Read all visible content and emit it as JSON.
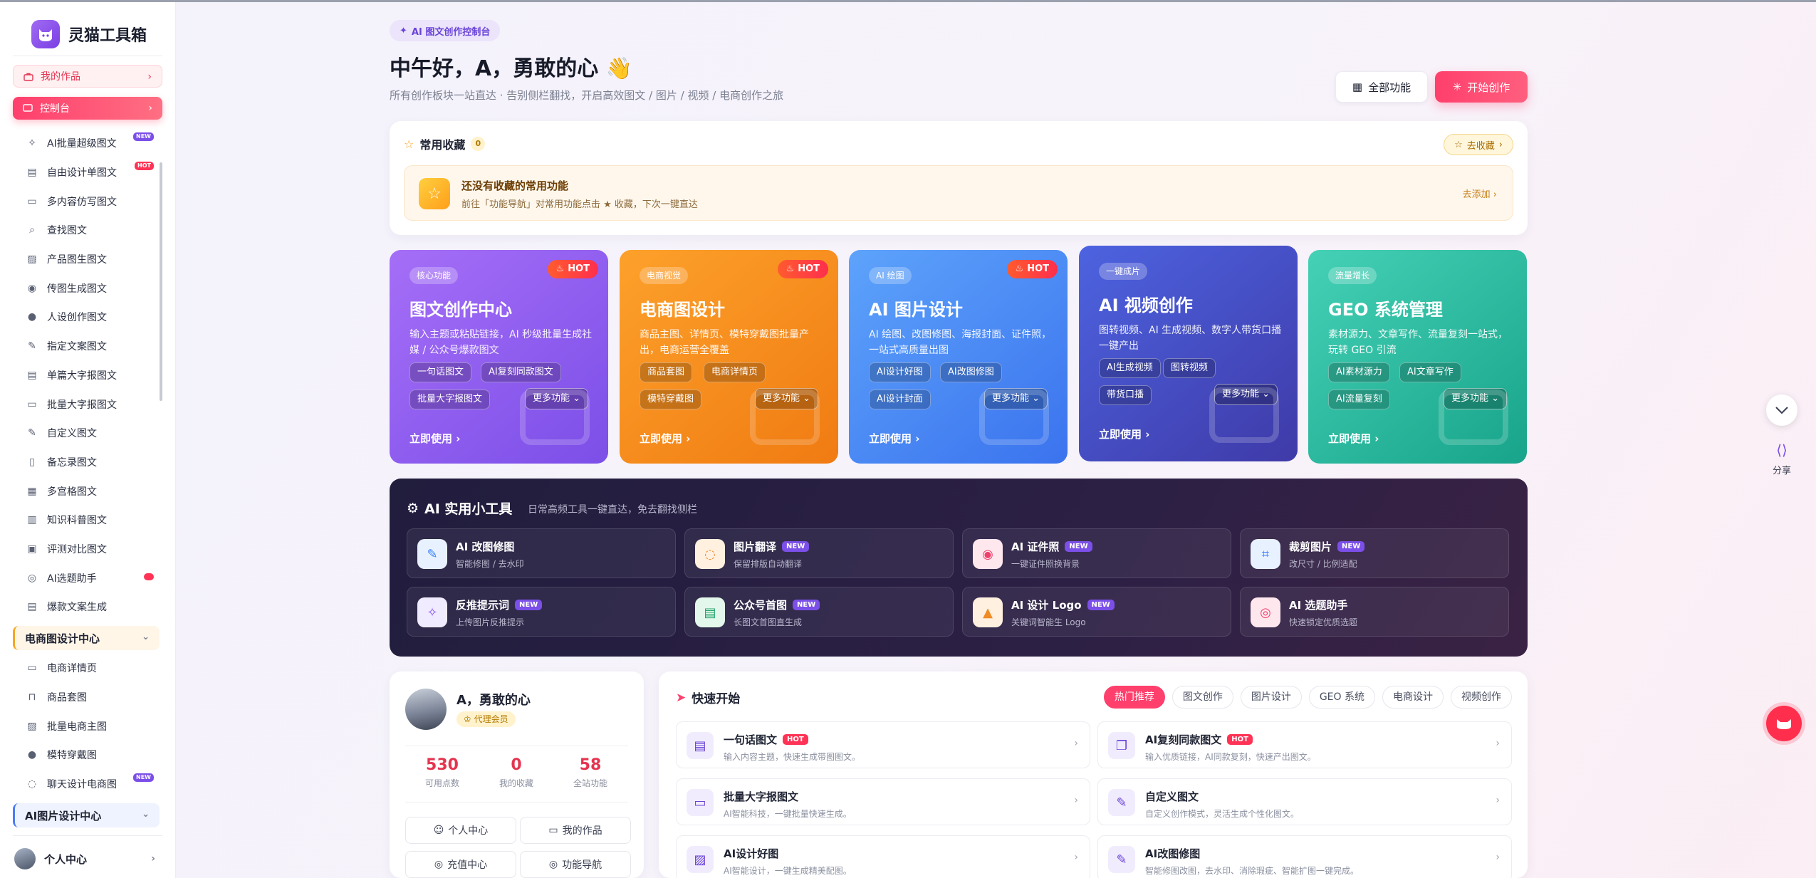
{
  "app": {
    "name": "灵猫工具箱"
  },
  "sidebar": {
    "works_label": "我的作品",
    "console_label": "控制台",
    "items": [
      {
        "label": "AI批量超级图文",
        "badge": "NEW",
        "icon": "sparkle-icon"
      },
      {
        "label": "自由设计单图文",
        "badge": "HOT",
        "icon": "doc-icon"
      },
      {
        "label": "多内容仿写图文",
        "badge": "",
        "icon": "stack-icon"
      },
      {
        "label": "查找图文",
        "badge": "",
        "icon": "search-icon"
      },
      {
        "label": "产品图生图文",
        "badge": "",
        "icon": "image-icon"
      },
      {
        "label": "传图生成图文",
        "badge": "",
        "icon": "camera-icon"
      },
      {
        "label": "人设创作图文",
        "badge": "",
        "icon": "user-icon"
      },
      {
        "label": "指定文案图文",
        "badge": "",
        "icon": "edit-icon"
      },
      {
        "label": "单篇大字报图文",
        "badge": "",
        "icon": "doc-icon"
      },
      {
        "label": "批量大字报图文",
        "badge": "",
        "icon": "stack-icon"
      },
      {
        "label": "自定义图文",
        "badge": "",
        "icon": "pen-icon"
      },
      {
        "label": "备忘录图文",
        "badge": "",
        "icon": "note-icon"
      },
      {
        "label": "多宫格图文",
        "badge": "",
        "icon": "grid-icon"
      },
      {
        "label": "知识科普图文",
        "badge": "",
        "icon": "book-icon"
      },
      {
        "label": "评测对比图文",
        "badge": "",
        "icon": "compare-icon"
      },
      {
        "label": "AI选题助手",
        "badge": "dot",
        "icon": "compass-icon"
      },
      {
        "label": "爆款文案生成",
        "badge": "",
        "icon": "doc-icon"
      }
    ],
    "group_ecommerce": "电商图设计中心",
    "ecommerce_items": [
      {
        "label": "电商详情页",
        "badge": "",
        "icon": "stack-icon"
      },
      {
        "label": "商品套图",
        "badge": "",
        "icon": "bag-icon"
      },
      {
        "label": "批量电商主图",
        "badge": "",
        "icon": "image-icon"
      },
      {
        "label": "模特穿戴图",
        "badge": "",
        "icon": "user-icon"
      },
      {
        "label": "聊天设计电商图",
        "badge": "NEW",
        "icon": "chat-icon"
      }
    ],
    "group_ai_image": "AI图片设计中心",
    "profile_label": "个人中心"
  },
  "header": {
    "chip": "AI 图文创作控制台",
    "greeting": "中午好，A，勇敢的心 👋",
    "subtitle": "所有创作板块一站直达 · 告别侧栏翻找，开启高效图文 / 图片 / 视频 / 电商创作之旅",
    "all_features": "全部功能",
    "start": "开始创作"
  },
  "favorites": {
    "title": "常用收藏",
    "count": "0",
    "go": "去收藏",
    "empty_title": "还没有收藏的常用功能",
    "empty_desc": "前往「功能导航」对常用功能点击 ★ 收藏，下次一键直达",
    "add": "去添加"
  },
  "features": [
    {
      "tag": "核心功能",
      "hot": "HOT",
      "title": "图文创作中心",
      "desc": "输入主题或粘贴链接，AI 秒级批量生成社媒 / 公众号爆款图文",
      "tags": [
        "一句话图文",
        "AI复刻同款图文",
        "批量大字报图文"
      ],
      "more": "更多功能",
      "use": "立即使用"
    },
    {
      "tag": "电商视觉",
      "hot": "HOT",
      "title": "电商图设计",
      "desc": "商品主图、详情页、模特穿戴图批量产出，电商运营全覆盖",
      "tags": [
        "商品套图",
        "电商详情页",
        "模特穿戴图"
      ],
      "more": "更多功能",
      "use": "立即使用"
    },
    {
      "tag": "AI 绘图",
      "hot": "HOT",
      "title": "AI 图片设计",
      "desc": "AI 绘图、改图修图、海报封面、证件照，一站式高质量出图",
      "tags": [
        "AI设计好图",
        "AI改图修图",
        "AI设计封面"
      ],
      "more": "更多功能",
      "use": "立即使用"
    },
    {
      "tag": "一键成片",
      "hot": "",
      "title": "AI 视频创作",
      "desc": "图转视频、AI 生成视频、数字人带货口播一键产出",
      "tags": [
        "AI生成视频",
        "图转视频",
        "带货口播"
      ],
      "more": "更多功能",
      "use": "立即使用"
    },
    {
      "tag": "流量增长",
      "hot": "",
      "title": "GEO 系统管理",
      "desc": "素材源力、文章写作、流量复刻一站式，玩转 GEO 引流",
      "tags": [
        "AI素材源力",
        "AI文章写作",
        "AI流量复刻"
      ],
      "more": "更多功能",
      "use": "立即使用"
    }
  ],
  "tools": {
    "title": "AI 实用小工具",
    "subtitle": "日常高频工具一键直达，免去翻找侧栏",
    "items": [
      {
        "name": "AI 改图修图",
        "badge": "",
        "desc": "智能修图 / 去水印",
        "icon": "pen-icon",
        "color": "#3b82f6",
        "bg": "#e8f1ff"
      },
      {
        "name": "图片翻译",
        "badge": "NEW",
        "desc": "保留排版自动翻译",
        "icon": "chat-icon",
        "color": "#f08a24",
        "bg": "#fff0df"
      },
      {
        "name": "AI 证件照",
        "badge": "NEW",
        "desc": "一键证件照换背景",
        "icon": "camera-icon",
        "color": "#ef3f6b",
        "bg": "#ffe7ee"
      },
      {
        "name": "裁剪图片",
        "badge": "NEW",
        "desc": "改尺寸 / 比例适配",
        "icon": "crop-icon",
        "color": "#3b82f6",
        "bg": "#e8f1ff"
      },
      {
        "name": "反推提示词",
        "badge": "NEW",
        "desc": "上传图片反推提示",
        "icon": "sparkle-icon",
        "color": "#8b5cf6",
        "bg": "#f1ebff"
      },
      {
        "name": "公众号首图",
        "badge": "NEW",
        "desc": "长图文首图直生成",
        "icon": "doc-icon",
        "color": "#22a36b",
        "bg": "#e3f7ec"
      },
      {
        "name": "AI 设计 Logo",
        "badge": "NEW",
        "desc": "关键词智能生 Logo",
        "icon": "chart-icon",
        "color": "#f08a24",
        "bg": "#fff0df"
      },
      {
        "name": "AI 选题助手",
        "badge": "",
        "desc": "快速锁定优质选题",
        "icon": "compass-icon",
        "color": "#ef3f6b",
        "bg": "#ffe7ee"
      }
    ]
  },
  "user": {
    "name": "A，勇敢的心",
    "membership": "代理会员",
    "stats": [
      {
        "value": "530",
        "label": "可用点数"
      },
      {
        "value": "0",
        "label": "我的收藏"
      },
      {
        "value": "58",
        "label": "全站功能"
      }
    ],
    "buttons": [
      "个人中心",
      "我的作品",
      "充值中心",
      "功能导航"
    ]
  },
  "quick": {
    "title": "快速开始",
    "tabs": [
      "热门推荐",
      "图文创作",
      "图片设计",
      "GEO 系统",
      "电商设计",
      "视频创作"
    ],
    "items": [
      {
        "name": "一句话图文",
        "badge": "HOT",
        "desc": "输入内容主题，快速生成带图图文。",
        "icon": "doc-icon"
      },
      {
        "name": "AI复刻同款图文",
        "badge": "HOT",
        "desc": "输入优质链接，AI同款复刻，快速产出图文。",
        "icon": "copy-icon"
      },
      {
        "name": "批量大字报图文",
        "badge": "",
        "desc": "AI智能科技，一键批量快速生成。",
        "icon": "stack-icon"
      },
      {
        "name": "自定义图文",
        "badge": "",
        "desc": "自定义创作模式，灵活生成个性化图文。",
        "icon": "pen-icon"
      },
      {
        "name": "AI设计好图",
        "badge": "",
        "desc": "AI智能设计，一键生成精美配图。",
        "icon": "image-icon"
      },
      {
        "name": "AI改图修图",
        "badge": "",
        "desc": "智能修图改图，去水印、消除瑕疵、智能扩图一键完成。",
        "icon": "pen-icon"
      }
    ]
  },
  "floating": {
    "share": "分享"
  },
  "colors": {
    "accent": "#ff3f6c",
    "brand": "#7b4fe8"
  }
}
